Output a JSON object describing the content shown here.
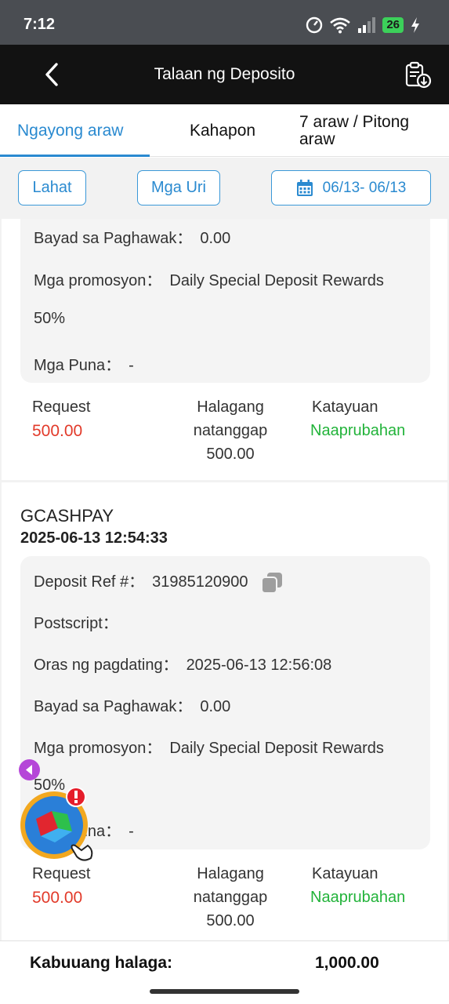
{
  "status_bar": {
    "time": "7:12",
    "battery": "26"
  },
  "header": {
    "title": "Talaan ng Deposito"
  },
  "tabs": [
    {
      "label": "Ngayong araw",
      "active": true
    },
    {
      "label": "Kahapon",
      "active": false
    },
    {
      "label": "7 araw / Pitong araw",
      "active": false
    }
  ],
  "filters": {
    "all": "Lahat",
    "types": "Mga Uri",
    "date_range": "06/13- 06/13"
  },
  "records": [
    {
      "fields": {
        "withdraw_fee_label": "Bayad sa Paghawak：",
        "withdraw_fee": "0.00",
        "promo_label": "Mga promosyon：",
        "promo": "Daily Special Deposit Rewards",
        "promo_cont": "50%",
        "remarks_label": "Mga Puna：",
        "remarks": "-"
      },
      "summary": {
        "request_label": "Request",
        "request": "500.00",
        "received_label_1": "Halagang",
        "received_label_2": "natanggap",
        "received": "500.00",
        "status_label": "Katayuan",
        "status": "Naaprubahan"
      }
    },
    {
      "method": "GCASHPAY",
      "datetime": "2025-06-13 12:54:33",
      "fields": {
        "ref_label": "Deposit Ref #：",
        "ref": "31985120900",
        "postscript_label": "Postscript：",
        "arrival_label": "Oras ng pagdating：",
        "arrival": "2025-06-13 12:56:08",
        "withdraw_fee_label": "Bayad sa Paghawak：",
        "withdraw_fee": "0.00",
        "promo_label": "Mga promosyon：",
        "promo": "Daily Special Deposit Rewards",
        "promo_cont": "50%",
        "remarks_label": "Mga Puna：",
        "remarks": "-"
      },
      "summary": {
        "request_label": "Request",
        "request": "500.00",
        "received_label_1": "Halagang",
        "received_label_2": "natanggap",
        "received": "500.00",
        "status_label": "Katayuan",
        "status": "Naaprubahan"
      }
    }
  ],
  "total": {
    "label": "Kabuuang halaga:",
    "value": "1,000.00"
  },
  "colors": {
    "accent": "#2a8ad0",
    "request": "#e23a2a",
    "approved": "#22b33a",
    "header_bg": "#121212"
  },
  "icons": [
    "back-arrow-icon",
    "export-clipboard-icon",
    "calendar-icon",
    "copy-icon",
    "wifi-icon",
    "signal-icon",
    "charging-icon"
  ]
}
